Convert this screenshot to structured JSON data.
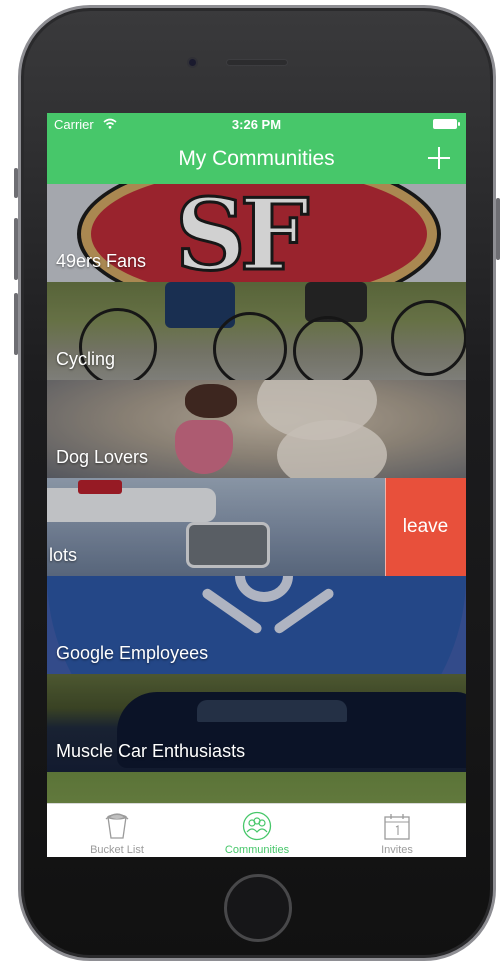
{
  "status_bar": {
    "carrier": "Carrier",
    "time": "3:26 PM"
  },
  "nav": {
    "title": "My Communities",
    "add_icon": "plus-icon"
  },
  "communities": [
    {
      "label": "49ers Fans"
    },
    {
      "label": "Cycling"
    },
    {
      "label": "Dog Lovers"
    },
    {
      "label": "lots",
      "swipe_action": "leave"
    },
    {
      "label": "Google Employees"
    },
    {
      "label": "Muscle Car Enthusiasts"
    }
  ],
  "tabs": [
    {
      "label": "Bucket List",
      "icon": "bucket-icon",
      "active": false
    },
    {
      "label": "Communities",
      "icon": "communities-icon",
      "active": true
    },
    {
      "label": "Invites",
      "icon": "calendar-icon",
      "active": false
    }
  ],
  "colors": {
    "accent": "#47c76a",
    "destructive": "#e8503b",
    "tab_inactive": "#9b9b9b"
  }
}
